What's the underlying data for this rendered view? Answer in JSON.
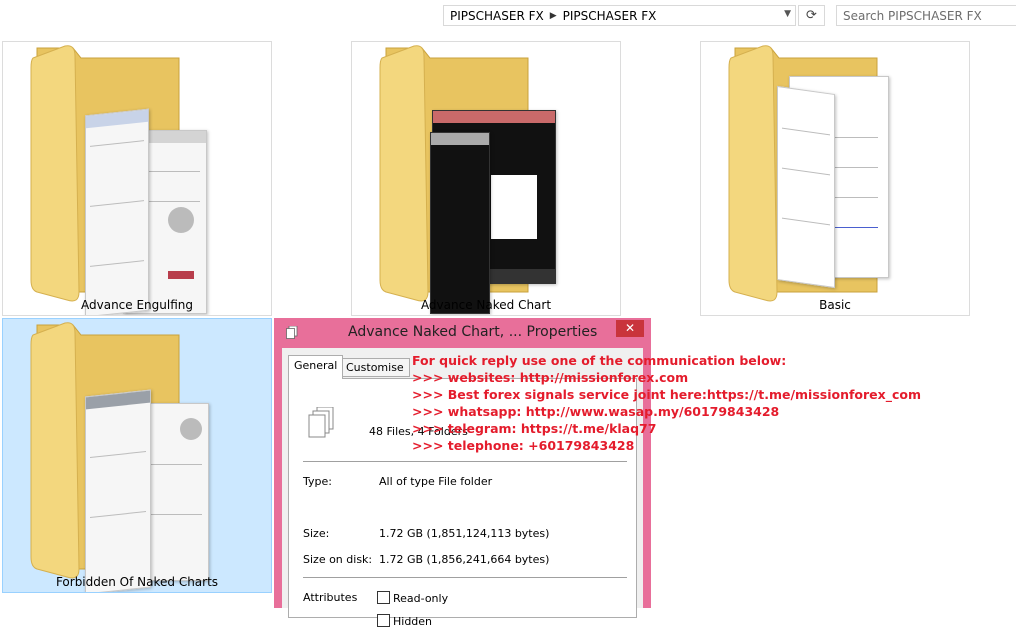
{
  "address": {
    "crumbs": [
      "PIPSCHASER FX",
      "PIPSCHASER FX"
    ]
  },
  "search": {
    "placeholder": "Search PIPSCHASER FX"
  },
  "folders": [
    {
      "label": "Advance Engulfing"
    },
    {
      "label": "Advance Naked Chart"
    },
    {
      "label": "Basic"
    },
    {
      "label": "Forbidden Of Naked Charts"
    }
  ],
  "dialog": {
    "title": "Advance Naked Chart, ... Properties",
    "close": "✕",
    "tabs": [
      "General",
      "Customise"
    ],
    "contains": "48 Files, 4 Folders",
    "rows": {
      "type_label": "Type:",
      "type_value": "All of type File folder",
      "size_label": "Size:",
      "size_value": "1.72 GB (1,851,124,113 bytes)",
      "disk_label": "Size on disk:",
      "disk_value": "1.72 GB (1,856,241,664 bytes)",
      "attr_label": "Attributes",
      "readonly": "Read-only",
      "hidden": "Hidden"
    }
  },
  "overlay": [
    "For quick reply use one of the communication below:",
    ">>> websites: http://missionforex.com",
    ">>> Best forex signals service joint here:https://t.me/missionforex_com",
    ">>> whatsapp: http://www.wasap.my/60179843428",
    ">>> telegram: https://t.me/klaq77",
    ">>> telephone: +60179843428"
  ],
  "colors": {
    "accent": "#e86f9a",
    "overlay_text": "#e41c2c",
    "selected": "#cce8ff",
    "folder": "#f2d57e"
  }
}
